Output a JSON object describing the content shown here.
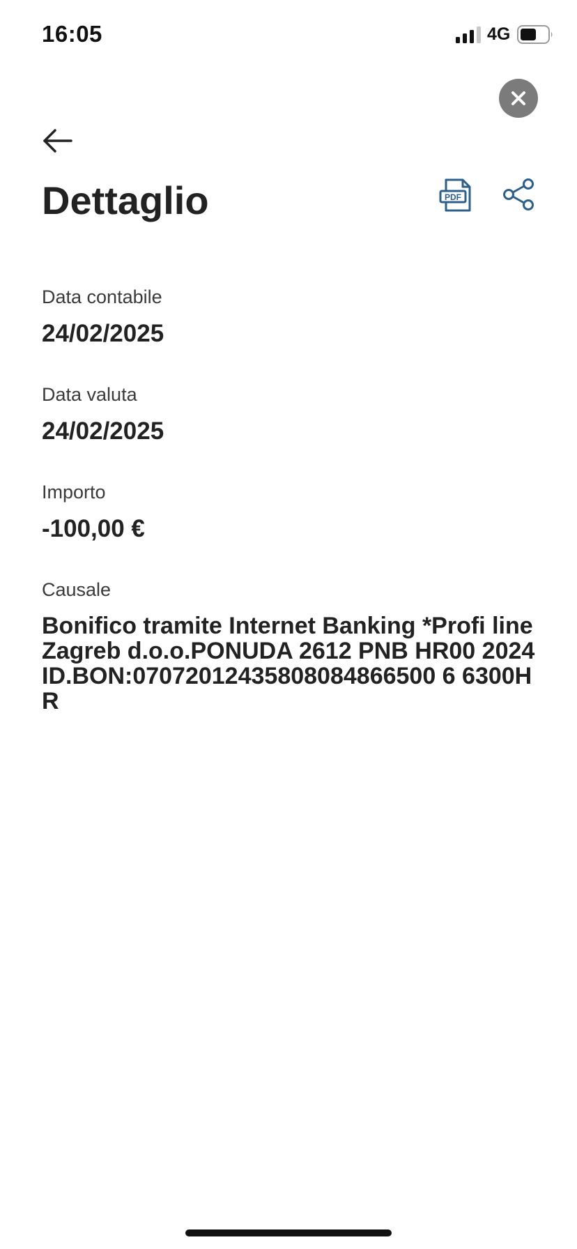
{
  "status_bar": {
    "time": "16:05",
    "network": "4G",
    "battery_level": 0.6
  },
  "header": {
    "title": "Dettaglio",
    "icons": {
      "close": "close-icon",
      "back": "arrow-left-icon",
      "pdf": "pdf-document-icon",
      "share": "share-icon"
    },
    "colors": {
      "accent": "#2c5f8a",
      "close_bg": "#7b7b7b"
    }
  },
  "fields": [
    {
      "label": "Data contabile",
      "value": "24/02/2025"
    },
    {
      "label": "Data valuta",
      "value": "24/02/2025"
    },
    {
      "label": "Importo",
      "value": "-100,00 €"
    },
    {
      "label": "Causale",
      "value": "Bonifico tramite Internet Banking *Profi line Zagreb d.o.o.PONUDA 2612 PNB HR00 2024ID.BON:07072012435808084866500 6 6300HR"
    }
  ],
  "pdf_icon_text": "PDF"
}
